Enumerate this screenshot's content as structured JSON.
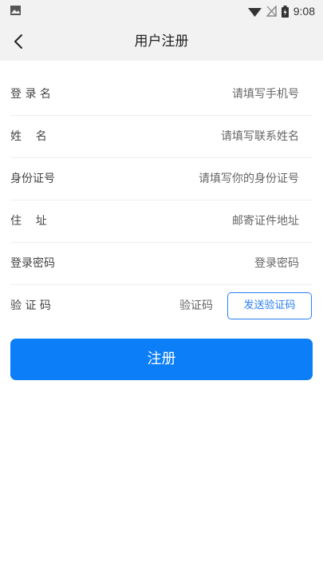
{
  "status_bar": {
    "time": "9:08",
    "icons": [
      "image-icon",
      "wifi-icon",
      "no-sim-icon",
      "battery-icon"
    ]
  },
  "header": {
    "title": "用户注册",
    "back_icon": "chevron-left-icon"
  },
  "form": {
    "rows": [
      {
        "label": "登 录 名",
        "placeholder": "请填写手机号"
      },
      {
        "label": "姓    名",
        "placeholder": "请填写联系姓名"
      },
      {
        "label": "身份证号",
        "placeholder": "请填写你的身份证号"
      },
      {
        "label": "住    址",
        "placeholder": "邮寄证件地址"
      },
      {
        "label": "登录密码",
        "placeholder": "登录密码"
      },
      {
        "label": "验 证 码",
        "placeholder": "验证码"
      }
    ],
    "send_code_label": "发送验证码"
  },
  "register_label": "注册",
  "colors": {
    "accent": "#0b7ef8",
    "header_bg": "#f2f2f2"
  }
}
